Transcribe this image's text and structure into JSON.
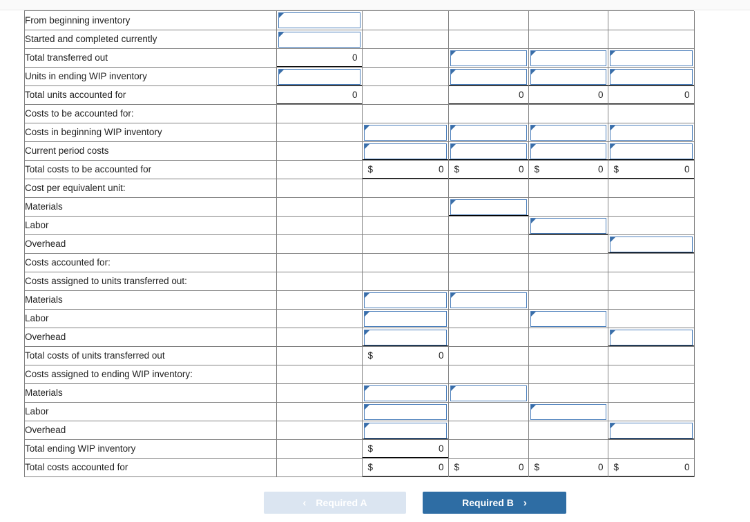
{
  "worksheet": {
    "columns": [
      "units",
      "col2",
      "col3",
      "col4",
      "col5"
    ],
    "rows": [
      {
        "label": "From beginning inventory",
        "indent": 2,
        "cells": [
          {
            "type": "input",
            "value": ""
          },
          {
            "type": "blank"
          },
          {
            "type": "blank"
          },
          {
            "type": "blank"
          },
          {
            "type": "blank"
          }
        ]
      },
      {
        "label": "Started and completed currently",
        "indent": 2,
        "cells": [
          {
            "type": "input",
            "value": ""
          },
          {
            "type": "blank"
          },
          {
            "type": "blank"
          },
          {
            "type": "blank"
          },
          {
            "type": "blank"
          }
        ]
      },
      {
        "label": "Total transferred out",
        "indent": 2,
        "cells": [
          {
            "type": "number",
            "value": "0",
            "dollar": false,
            "rule": "single"
          },
          {
            "type": "blank"
          },
          {
            "type": "input",
            "value": ""
          },
          {
            "type": "input",
            "value": ""
          },
          {
            "type": "input",
            "value": ""
          }
        ]
      },
      {
        "label": "Units in ending WIP inventory",
        "indent": 1,
        "cells": [
          {
            "type": "input",
            "value": "",
            "rule": "single"
          },
          {
            "type": "blank"
          },
          {
            "type": "input",
            "value": "",
            "rule": "single"
          },
          {
            "type": "input",
            "value": "",
            "rule": "single"
          },
          {
            "type": "input",
            "value": "",
            "rule": "single"
          }
        ]
      },
      {
        "label": "Total units accounted for",
        "indent": 0,
        "cells": [
          {
            "type": "number",
            "value": "0",
            "dollar": false,
            "rule": "double"
          },
          {
            "type": "blank"
          },
          {
            "type": "number",
            "value": "0",
            "dollar": false,
            "rule": "double"
          },
          {
            "type": "number",
            "value": "0",
            "dollar": false,
            "rule": "double"
          },
          {
            "type": "number",
            "value": "0",
            "dollar": false,
            "rule": "double"
          }
        ]
      },
      {
        "label": "Costs to be accounted for:",
        "indent": 0,
        "cells": [
          {
            "type": "blank"
          },
          {
            "type": "blank"
          },
          {
            "type": "blank"
          },
          {
            "type": "blank"
          },
          {
            "type": "blank"
          }
        ]
      },
      {
        "label": "Costs in beginning WIP inventory",
        "indent": 1,
        "cells": [
          {
            "type": "blank"
          },
          {
            "type": "input",
            "value": ""
          },
          {
            "type": "input",
            "value": ""
          },
          {
            "type": "input",
            "value": ""
          },
          {
            "type": "input",
            "value": ""
          }
        ]
      },
      {
        "label": "Current period costs",
        "indent": 1,
        "cells": [
          {
            "type": "blank"
          },
          {
            "type": "input",
            "value": "",
            "rule": "single"
          },
          {
            "type": "input",
            "value": "",
            "rule": "single"
          },
          {
            "type": "input",
            "value": "",
            "rule": "single"
          },
          {
            "type": "input",
            "value": "",
            "rule": "single"
          }
        ]
      },
      {
        "label": "Total costs to be accounted for",
        "indent": 0,
        "cells": [
          {
            "type": "blank"
          },
          {
            "type": "number",
            "value": "0",
            "dollar": true,
            "rule": "double"
          },
          {
            "type": "number",
            "value": "0",
            "dollar": true,
            "rule": "double"
          },
          {
            "type": "number",
            "value": "0",
            "dollar": true,
            "rule": "double"
          },
          {
            "type": "number",
            "value": "0",
            "dollar": true,
            "rule": "double"
          }
        ]
      },
      {
        "label": "Cost per equivalent unit:",
        "indent": 0,
        "cells": [
          {
            "type": "blank"
          },
          {
            "type": "blank"
          },
          {
            "type": "blank"
          },
          {
            "type": "blank"
          },
          {
            "type": "blank"
          }
        ]
      },
      {
        "label": "Materials",
        "indent": 1,
        "cells": [
          {
            "type": "blank"
          },
          {
            "type": "blank"
          },
          {
            "type": "input",
            "value": "",
            "rule": "double"
          },
          {
            "type": "blank"
          },
          {
            "type": "blank"
          }
        ]
      },
      {
        "label": "Labor",
        "indent": 1,
        "cells": [
          {
            "type": "blank"
          },
          {
            "type": "blank"
          },
          {
            "type": "blank"
          },
          {
            "type": "input",
            "value": "",
            "rule": "double"
          },
          {
            "type": "blank"
          }
        ]
      },
      {
        "label": "Overhead",
        "indent": 1,
        "cells": [
          {
            "type": "blank"
          },
          {
            "type": "blank"
          },
          {
            "type": "blank"
          },
          {
            "type": "blank"
          },
          {
            "type": "input",
            "value": "",
            "rule": "double"
          }
        ]
      },
      {
        "label": "Costs accounted for:",
        "indent": 0,
        "cells": [
          {
            "type": "blank"
          },
          {
            "type": "blank"
          },
          {
            "type": "blank"
          },
          {
            "type": "blank"
          },
          {
            "type": "blank"
          }
        ]
      },
      {
        "label": "Costs assigned to units transferred out:",
        "indent": 1,
        "cells": [
          {
            "type": "blank"
          },
          {
            "type": "blank"
          },
          {
            "type": "blank"
          },
          {
            "type": "blank"
          },
          {
            "type": "blank"
          }
        ]
      },
      {
        "label": "Materials",
        "indent": 2,
        "cells": [
          {
            "type": "blank"
          },
          {
            "type": "input",
            "value": ""
          },
          {
            "type": "input",
            "value": ""
          },
          {
            "type": "blank"
          },
          {
            "type": "blank"
          }
        ]
      },
      {
        "label": "Labor",
        "indent": 2,
        "cells": [
          {
            "type": "blank"
          },
          {
            "type": "input",
            "value": ""
          },
          {
            "type": "blank"
          },
          {
            "type": "input",
            "value": ""
          },
          {
            "type": "blank"
          }
        ]
      },
      {
        "label": "Overhead",
        "indent": 2,
        "cells": [
          {
            "type": "blank"
          },
          {
            "type": "input",
            "value": "",
            "rule": "single"
          },
          {
            "type": "blank"
          },
          {
            "type": "blank"
          },
          {
            "type": "input",
            "value": "",
            "rule": "single"
          }
        ]
      },
      {
        "label": "Total costs of units transferred out",
        "indent": 1,
        "cells": [
          {
            "type": "blank"
          },
          {
            "type": "number",
            "value": "0",
            "dollar": true
          },
          {
            "type": "blank"
          },
          {
            "type": "blank"
          },
          {
            "type": "blank"
          }
        ]
      },
      {
        "label": "Costs assigned to ending WIP inventory:",
        "indent": 0,
        "cells": [
          {
            "type": "blank"
          },
          {
            "type": "blank"
          },
          {
            "type": "blank"
          },
          {
            "type": "blank"
          },
          {
            "type": "blank"
          }
        ]
      },
      {
        "label": "Materials",
        "indent": 2,
        "cells": [
          {
            "type": "blank"
          },
          {
            "type": "input",
            "value": ""
          },
          {
            "type": "input",
            "value": ""
          },
          {
            "type": "blank"
          },
          {
            "type": "blank"
          }
        ]
      },
      {
        "label": "Labor",
        "indent": 2,
        "cells": [
          {
            "type": "blank"
          },
          {
            "type": "input",
            "value": ""
          },
          {
            "type": "blank"
          },
          {
            "type": "input",
            "value": ""
          },
          {
            "type": "blank"
          }
        ]
      },
      {
        "label": "Overhead",
        "indent": 2,
        "cells": [
          {
            "type": "blank"
          },
          {
            "type": "input",
            "value": "",
            "rule": "single"
          },
          {
            "type": "blank"
          },
          {
            "type": "blank"
          },
          {
            "type": "input",
            "value": "",
            "rule": "single"
          }
        ]
      },
      {
        "label": "Total ending WIP inventory",
        "indent": 1,
        "cells": [
          {
            "type": "blank"
          },
          {
            "type": "number",
            "value": "0",
            "dollar": true,
            "rule": "single"
          },
          {
            "type": "blank"
          },
          {
            "type": "blank"
          },
          {
            "type": "blank"
          }
        ]
      },
      {
        "label": "Total costs accounted for",
        "indent": 0,
        "cells": [
          {
            "type": "blank"
          },
          {
            "type": "number",
            "value": "0",
            "dollar": true,
            "rule": "double"
          },
          {
            "type": "number",
            "value": "0",
            "dollar": true,
            "rule": "double"
          },
          {
            "type": "number",
            "value": "0",
            "dollar": true,
            "rule": "double"
          },
          {
            "type": "number",
            "value": "0",
            "dollar": true,
            "rule": "double"
          }
        ]
      }
    ]
  },
  "footer": {
    "prev_label": "Required A",
    "next_label": "Required B",
    "prev_chevron": "‹",
    "next_chevron": "›"
  },
  "dollar_symbol": "$",
  "colors": {
    "input_border": "#4a7ebb",
    "grid_line": "#808080",
    "button_prev_bg": "#dbe5f1",
    "button_next_bg": "#2e6da4",
    "text": "#222222"
  }
}
